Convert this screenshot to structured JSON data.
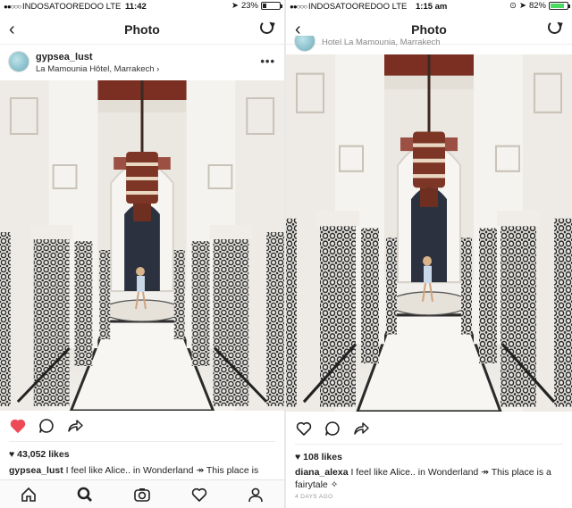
{
  "left": {
    "status": {
      "signal": "●●○○○",
      "carrier": "INDOSATOOREDOO",
      "network": "LTE",
      "time": "11:42",
      "battery": "23%",
      "battery_color": "#222222",
      "battery_level": 0.23
    },
    "nav": {
      "back": "‹",
      "title": "Photo"
    },
    "post": {
      "username": "gypsea_lust",
      "location": "La Mamounia Hôtel, Marrakech",
      "more": "•••",
      "likes": "43,052 likes",
      "caption_user": "gypsea_lust",
      "caption_text": "I feel like Alice.. in Wonderland ↠ This place is",
      "liked": true
    }
  },
  "right": {
    "status": {
      "signal": "●●○○○",
      "carrier": "INDOSATOOREDOO",
      "network": "LTE",
      "time": "1:15 am",
      "battery": "82%",
      "battery_color": "#4cd964",
      "battery_level": 0.82
    },
    "nav": {
      "back": "‹",
      "title": "Photo"
    },
    "post": {
      "location_partial": "Hotel La Mamounia, Marrakech",
      "likes": "108 likes",
      "caption_user": "diana_alexa",
      "caption_text": "I feel like Alice.. in Wonderland ↠ This place is a fairytale ✧",
      "timestamp": "4 DAYS AGO",
      "liked": false
    }
  },
  "icons": [
    "back-icon",
    "refresh-icon",
    "heart-icon",
    "comment-icon",
    "share-icon",
    "home-icon",
    "search-icon",
    "camera-icon",
    "activity-heart-icon",
    "profile-icon"
  ],
  "colors": {
    "like_red": "#ed4956",
    "text": "#222222"
  }
}
